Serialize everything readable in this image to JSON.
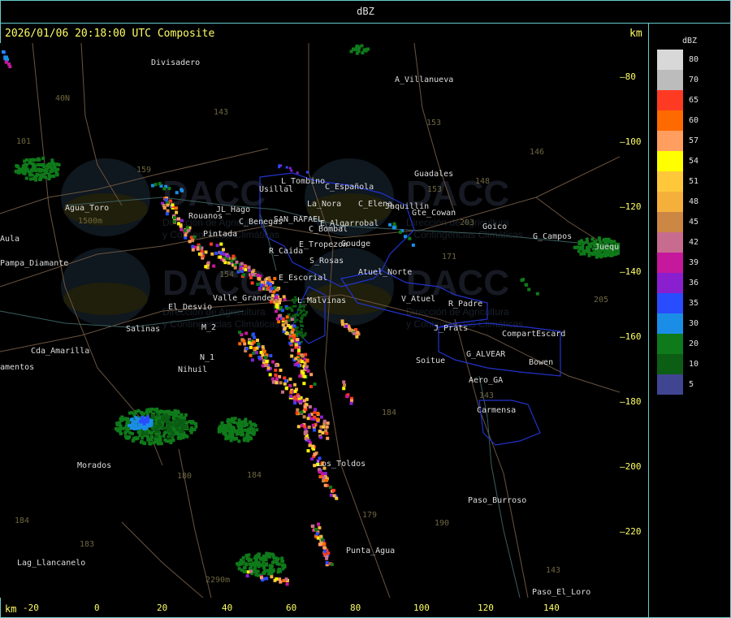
{
  "header": {
    "title": "dBZ"
  },
  "info": {
    "datetime_product": "2026/01/06 20:18:00 UTC Composite",
    "km_label_top": "km",
    "km_label_bottom": "km"
  },
  "legend": {
    "title": "dBZ",
    "entries": [
      {
        "label": "80",
        "color": "#d8d8d8"
      },
      {
        "label": "70",
        "color": "#bcbcbc"
      },
      {
        "label": "65",
        "color": "#ff3a22"
      },
      {
        "label": "60",
        "color": "#ff6a00"
      },
      {
        "label": "57",
        "color": "#ff9e5e"
      },
      {
        "label": "54",
        "color": "#ffff00"
      },
      {
        "label": "51",
        "color": "#ffc83a"
      },
      {
        "label": "48",
        "color": "#f5b03c"
      },
      {
        "label": "45",
        "color": "#cd8744"
      },
      {
        "label": "42",
        "color": "#c76c8e"
      },
      {
        "label": "39",
        "color": "#c6189c"
      },
      {
        "label": "36",
        "color": "#8a1fd0"
      },
      {
        "label": "35",
        "color": "#2a4cff"
      },
      {
        "label": "30",
        "color": "#1a8ee6"
      },
      {
        "label": "20",
        "color": "#0f7a1a"
      },
      {
        "label": "10",
        "color": "#0b5e14"
      },
      {
        "label": "5",
        "color": "#404592"
      }
    ]
  },
  "axes": {
    "y_ticks": [
      "-80",
      "-100",
      "-120",
      "-140",
      "-160",
      "-180",
      "-200",
      "-220"
    ],
    "x_ticks": [
      "-20",
      "0",
      "20",
      "40",
      "60",
      "80",
      "100",
      "120",
      "140"
    ]
  },
  "places": [
    {
      "name": "Divisadero"
    },
    {
      "name": "A_Villanueva"
    },
    {
      "name": "Guadales"
    },
    {
      "name": "L_Tombino"
    },
    {
      "name": "Usillal"
    },
    {
      "name": "C_Española"
    },
    {
      "name": "La_Nora"
    },
    {
      "name": "C_Elena"
    },
    {
      "name": "Jaquillin"
    },
    {
      "name": "Gte_Cowan"
    },
    {
      "name": "Goico"
    },
    {
      "name": "G_Campos"
    },
    {
      "name": "Jueque"
    },
    {
      "name": "Agua_Toro"
    },
    {
      "name": "Rouanos"
    },
    {
      "name": "JL_Hago"
    },
    {
      "name": "C_Benegas"
    },
    {
      "name": "SAN_RAFAEL"
    },
    {
      "name": "E_Algarrobal"
    },
    {
      "name": "C_Bombal"
    },
    {
      "name": "Pintada"
    },
    {
      "name": "R_Caida"
    },
    {
      "name": "E_Tropezon"
    },
    {
      "name": "Goudge"
    },
    {
      "name": "Pampa_Diamante"
    },
    {
      "name": "Aula"
    },
    {
      "name": "S_Rosas"
    },
    {
      "name": "Atuel_Norte"
    },
    {
      "name": "E_Escorial"
    },
    {
      "name": "El_Desvio"
    },
    {
      "name": "Valle_Grande"
    },
    {
      "name": "L_Malvinas"
    },
    {
      "name": "V_Atuel"
    },
    {
      "name": "R_Padre"
    },
    {
      "name": "Salinas"
    },
    {
      "name": "M_2"
    },
    {
      "name": "J_Prats"
    },
    {
      "name": "CompartEscard"
    },
    {
      "name": "Cda_Amarilla"
    },
    {
      "name": "N_1"
    },
    {
      "name": "Nihuil"
    },
    {
      "name": "Soitue"
    },
    {
      "name": "G_ALVEAR"
    },
    {
      "name": "Bowen"
    },
    {
      "name": "Aero_GA"
    },
    {
      "name": "Carmensa"
    },
    {
      "name": "Morados"
    },
    {
      "name": "Los_Toldos"
    },
    {
      "name": "Paso_Burroso"
    },
    {
      "name": "Punta_Agua"
    },
    {
      "name": "Lag_Llancanelo"
    },
    {
      "name": "Paso_El_Loro"
    },
    {
      "name": "amentos"
    }
  ],
  "elevations": [
    {
      "label": "143"
    },
    {
      "label": "153"
    },
    {
      "label": "146"
    },
    {
      "label": "148"
    },
    {
      "label": "101"
    },
    {
      "label": "40N"
    },
    {
      "label": "159"
    },
    {
      "label": "153"
    },
    {
      "label": "203"
    },
    {
      "label": "171"
    },
    {
      "label": "205"
    },
    {
      "label": "154"
    },
    {
      "label": "184"
    },
    {
      "label": "180"
    },
    {
      "label": "184"
    },
    {
      "label": "179"
    },
    {
      "label": "190"
    },
    {
      "label": "183"
    },
    {
      "label": "184"
    },
    {
      "label": "143"
    },
    {
      "label": "143"
    },
    {
      "label": "2290m"
    },
    {
      "label": "1500m"
    }
  ],
  "watermark": {
    "logo_text": "DACC",
    "line1": "Dirección de Agricultura",
    "line2": "y Contingencias Climáticas"
  }
}
